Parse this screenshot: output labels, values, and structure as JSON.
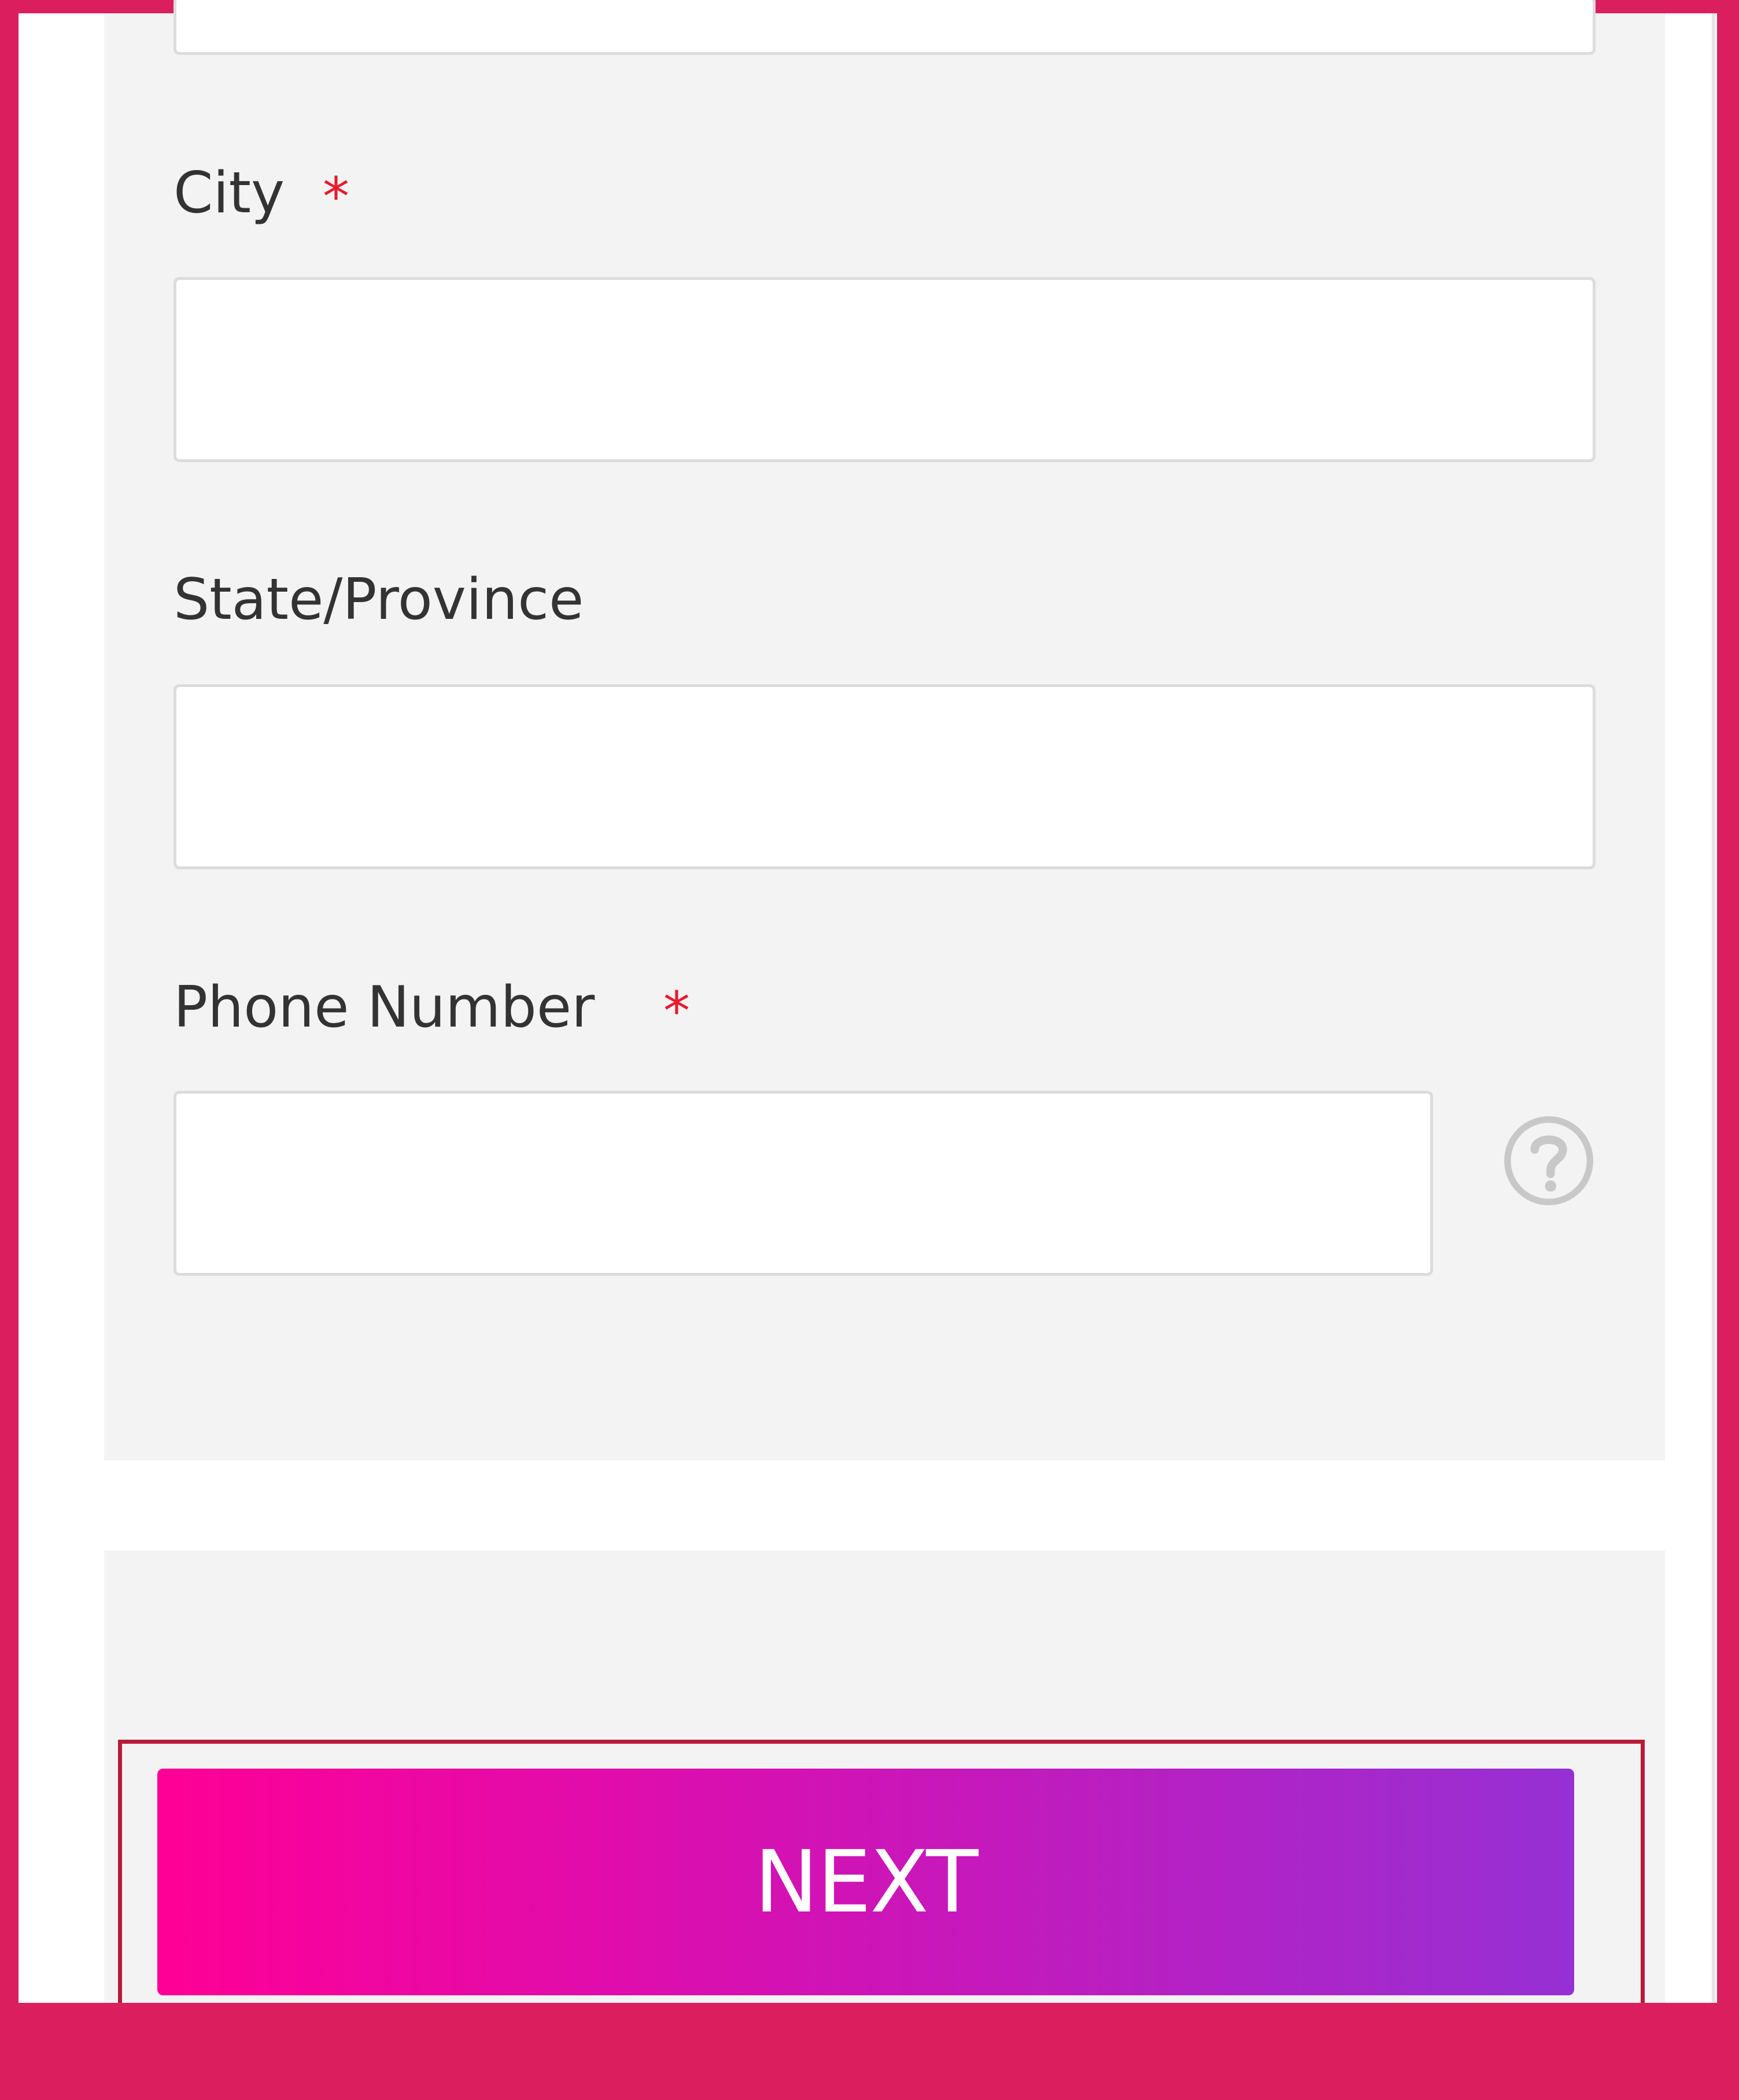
{
  "form": {
    "city": {
      "label": "City",
      "required_marker": "*",
      "value": ""
    },
    "state": {
      "label": "State/Province",
      "value": ""
    },
    "phone": {
      "label": "Phone Number",
      "required_marker": "*",
      "value": "",
      "help_icon": "help-circle-icon"
    }
  },
  "actions": {
    "next_label": "NEXT"
  },
  "colors": {
    "frame": "#DB1F5E",
    "panel": "#F3F3F3",
    "required": "#E8192C",
    "button_gradient_start": "#FF0096",
    "button_gradient_end": "#9630D4",
    "focus_outline": "#B71C37"
  }
}
